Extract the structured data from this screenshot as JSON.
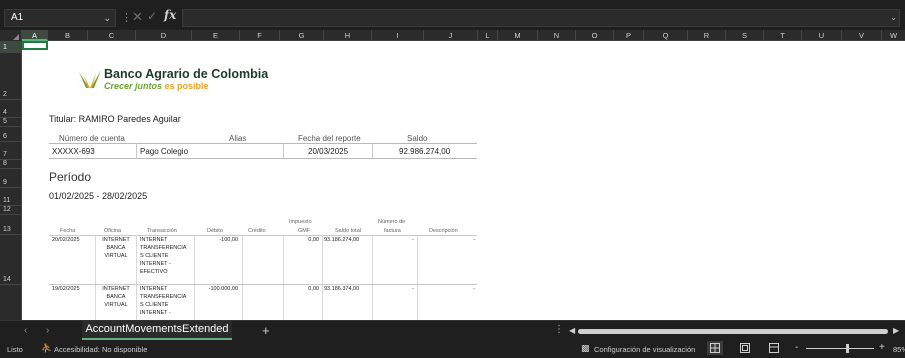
{
  "formula_bar": {
    "name_box": "A1",
    "fx_label": "fx",
    "formula": ""
  },
  "columns": [
    "A",
    "B",
    "C",
    "D",
    "E",
    "F",
    "G",
    "H",
    "I",
    "J",
    "L",
    "M",
    "N",
    "O",
    "P",
    "Q",
    "R",
    "S",
    "T",
    "U",
    "V",
    "W"
  ],
  "rows": [
    "1",
    "2",
    "4",
    "5",
    "6",
    "7",
    "8",
    "9",
    "11",
    "12",
    "13",
    "14"
  ],
  "bank": {
    "name": "Banco Agrario de Colombia",
    "slogan_part1": "Crecer juntos",
    "slogan_part2": "es posible",
    "colors": {
      "green": "#6ba42c",
      "orange": "#f2a024",
      "dark": "#1d3b2a"
    }
  },
  "titular": "Titular: RAMIRO Paredes Aguilar",
  "account": {
    "headers": {
      "numero": "Número de cuenta",
      "alias": "Alias",
      "fecha": "Fecha del reporte",
      "saldo": "Saldo"
    },
    "values": {
      "numero": "XXXXX-693",
      "alias": "Pago Colegio",
      "fecha": "20/03/2025",
      "saldo": "92.986.274,00"
    }
  },
  "periodo_title": "Período",
  "periodo_range": "01/02/2025 - 28/02/2025",
  "movements": {
    "headers": {
      "fecha": "Fecha",
      "oficina": "Oficina",
      "transaccion": "Transacción",
      "debito": "Débito",
      "credito": "Crédito",
      "impuesto_l1": "Impuesto",
      "impuesto_l2": "GMF",
      "saldo_total": "Saldo total",
      "factura_l1": "Número de",
      "factura_l2": "factura",
      "descripcion": "Descripción"
    },
    "rows": [
      {
        "fecha": "20/02/2025",
        "oficina": [
          "INTERNET",
          "BANCA",
          "VIRTUAL"
        ],
        "transaccion": [
          "INTERNET",
          "TRANSFERENCIA",
          "S CLIENTE",
          "INTERNET -",
          "EFECTIVO"
        ],
        "debito": "-100,00",
        "credito": "",
        "impuesto": "0,00",
        "saldo_total": "93.186.274,00",
        "factura": "-",
        "descripcion": "-"
      },
      {
        "fecha": "19/02/2025",
        "oficina": [
          "INTERNET",
          "BANCA",
          "VIRTUAL"
        ],
        "transaccion": [
          "INTERNET",
          "TRANSFERENCIA",
          "S CLIENTE",
          "INTERNET -"
        ],
        "debito": "-100.000,00",
        "credito": "",
        "impuesto": "0,00",
        "saldo_total": "93.186.374,00",
        "factura": "-",
        "descripcion": "-"
      }
    ]
  },
  "tabs": {
    "active": "AccountMovementsExtended",
    "add": "+"
  },
  "status": {
    "ready": "Listo",
    "accessibility": "Accesibilidad: No disponible",
    "view_settings": "Configuración de visualización",
    "zoom_minus": "-",
    "zoom_plus": "+",
    "zoom": "85%"
  }
}
